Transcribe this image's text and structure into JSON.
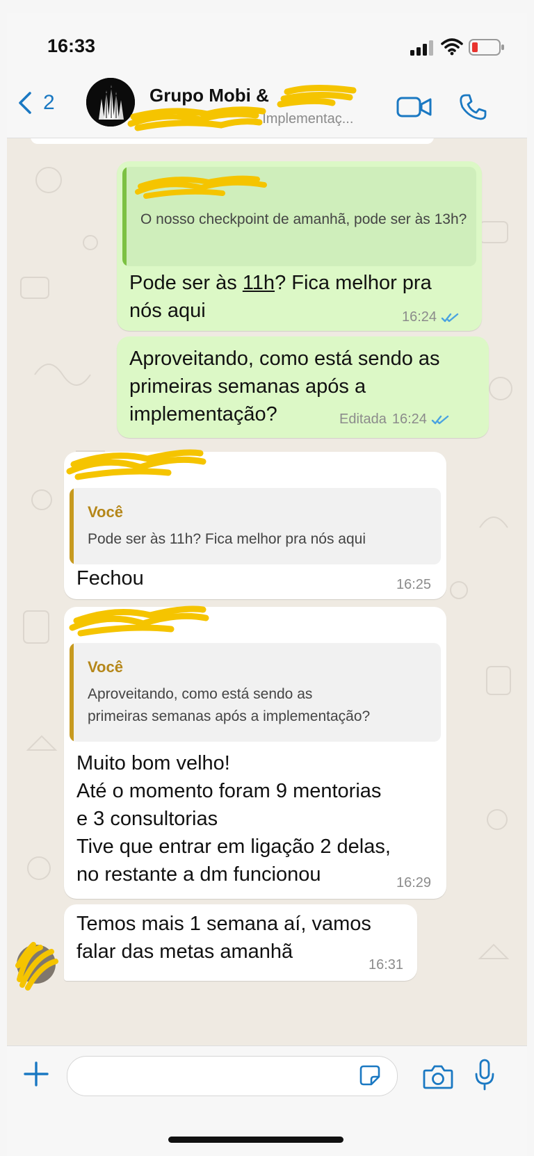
{
  "status_bar": {
    "time": "16:33"
  },
  "header": {
    "back_count": "2",
    "group_name": "Grupo Mobi & ",
    "subtitle": "- Implementaç..."
  },
  "messages": [
    {
      "direction": "outgoing",
      "quote_text": "O nosso checkpoint de amanhã, pode ser às 13h?",
      "text_before_link": "Pode ser às ",
      "link_text": "11h",
      "text_after_link": "? Fica melhor pra nós aqui",
      "time": "16:24"
    },
    {
      "direction": "outgoing",
      "text": "Aproveitando, como está sendo as primeiras semanas após a implementação?",
      "edited_label": "Editada",
      "time": "16:24"
    },
    {
      "direction": "incoming",
      "quote_author": "Você",
      "quote_text": "Pode ser às 11h? Fica melhor pra nós aqui",
      "text": "Fechou",
      "time": "16:25"
    },
    {
      "direction": "incoming",
      "quote_author": "Você",
      "quote_text_line1": "Aproveitando, como está sendo as",
      "quote_text_line2": "primeiras semanas após a implementação?",
      "lines": [
        "Muito bom velho!",
        "Até o momento foram 9 mentorias",
        "e 3 consultorias",
        "Tive que entrar em ligação 2 delas,",
        "no restante a dm funcionou"
      ],
      "time": "16:29"
    },
    {
      "direction": "incoming",
      "lines": [
        "Temos mais 1 semana aí, vamos",
        "falar das metas amanhã"
      ],
      "time": "16:31"
    }
  ],
  "colors": {
    "accent": "#1a78c2",
    "outgoing_bubble": "#dcf8c6",
    "incoming_bubble": "#ffffff",
    "quote_bar_out": "#7cc142",
    "quote_bar_in": "#c79a1f",
    "redaction": "#f5c400"
  },
  "icons": {
    "back": "chevron-left-icon",
    "video": "video-camera-icon",
    "call": "phone-icon",
    "attach": "plus-icon",
    "sticker": "sticker-icon",
    "camera": "camera-icon",
    "mic": "microphone-icon"
  }
}
